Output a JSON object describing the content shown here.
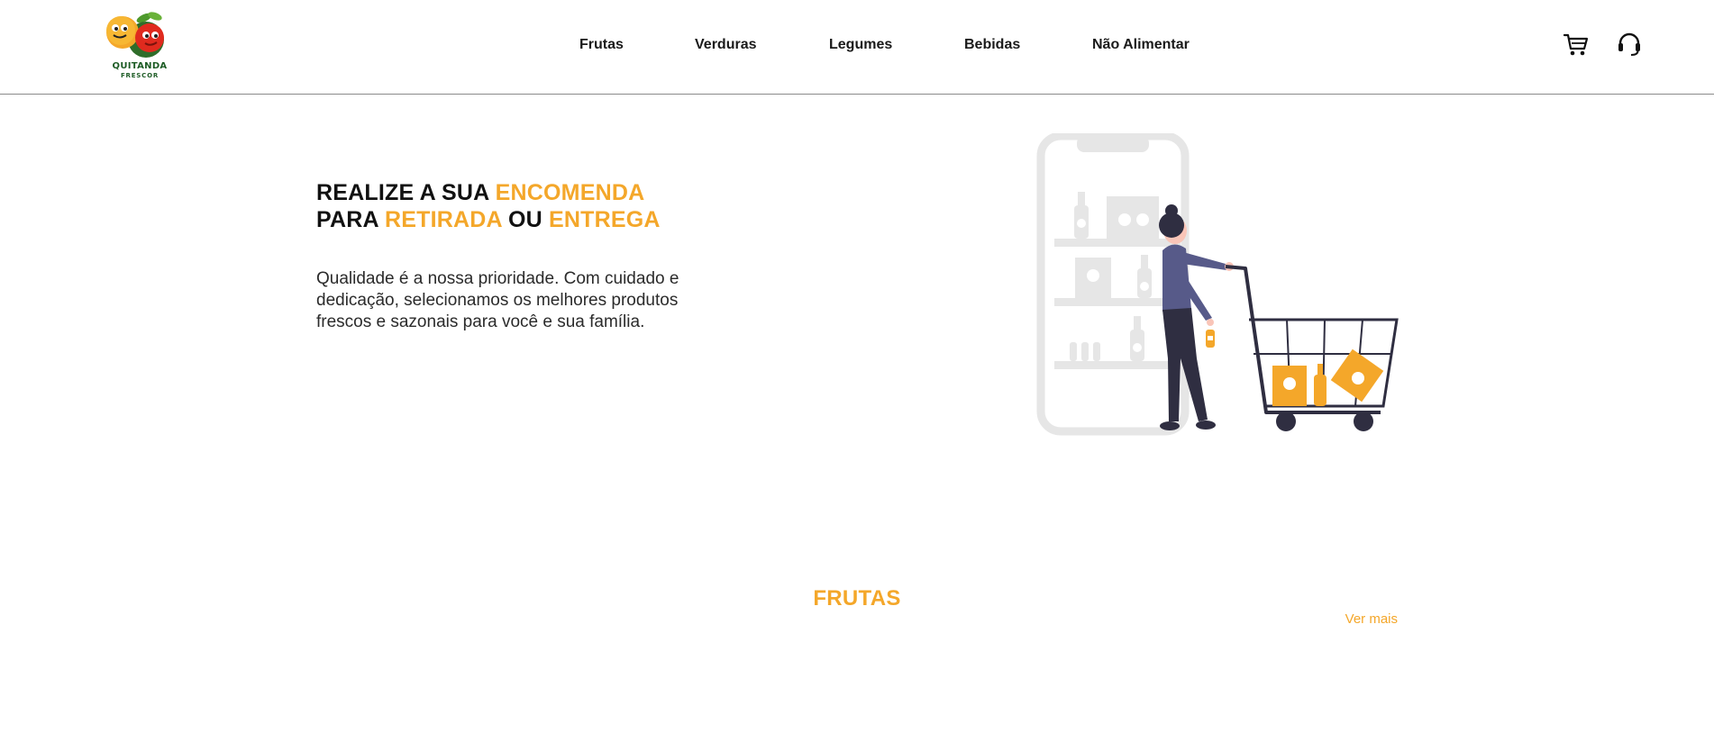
{
  "brand": {
    "name_line1": "QUITANDA",
    "name_line2": "FRESCOR"
  },
  "nav": {
    "items": [
      {
        "label": "Frutas"
      },
      {
        "label": "Verduras"
      },
      {
        "label": "Legumes"
      },
      {
        "label": "Bebidas"
      },
      {
        "label": "Não Alimentar"
      }
    ]
  },
  "header_icons": {
    "cart": "cart-icon",
    "support": "headset-icon"
  },
  "hero": {
    "title": {
      "w1": "REALIZE A SUA ",
      "w2": "ENCOMENDA",
      "w3": "PARA ",
      "w4": "RETIRADA",
      "w5": " OU ",
      "w6": "ENTREGA"
    },
    "description": "Qualidade é a nossa prioridade. Com cuidado e dedicação, selecionamos os melhores produtos frescos e sazonais para você e sua família."
  },
  "section": {
    "title": "FRUTAS",
    "see_more": "Ver mais"
  },
  "colors": {
    "accent": "#f4a72a",
    "text": "#111111",
    "figure_dark": "#2f2e41",
    "figure_shirt": "#575a89",
    "phone_gray": "#e6e6e6"
  }
}
